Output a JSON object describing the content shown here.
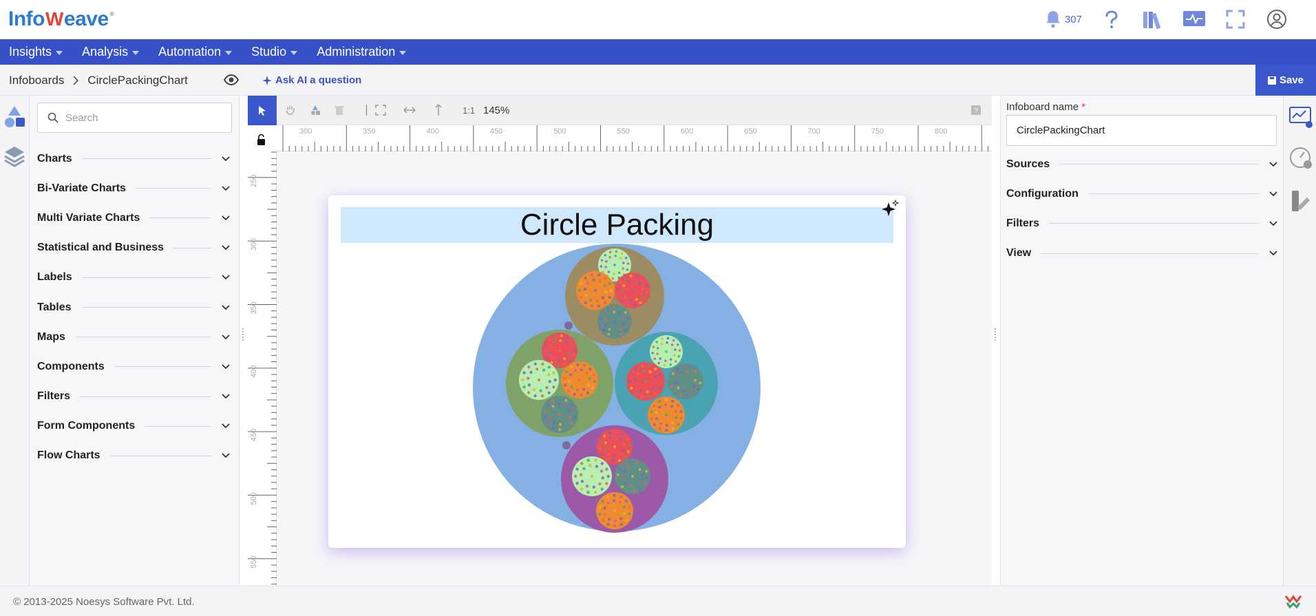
{
  "app": {
    "logo_part1": "Info",
    "logo_part2": "W",
    "logo_part3": "eave",
    "logo_reg": "®",
    "notification_count": "307"
  },
  "nav": {
    "items": [
      {
        "label": "Insights"
      },
      {
        "label": "Analysis"
      },
      {
        "label": "Automation"
      },
      {
        "label": "Studio"
      },
      {
        "label": "Administration"
      }
    ]
  },
  "breadcrumb": {
    "root": "Infoboards",
    "current": "CirclePackingChart"
  },
  "actions": {
    "ask_ai": "Ask AI a question",
    "save": "Save"
  },
  "components": {
    "search_placeholder": "Search",
    "categories": [
      {
        "label": "Charts"
      },
      {
        "label": "Bi-Variate Charts"
      },
      {
        "label": "Multi Variate Charts"
      },
      {
        "label": "Statistical and Business"
      },
      {
        "label": "Labels"
      },
      {
        "label": "Tables"
      },
      {
        "label": "Maps"
      },
      {
        "label": "Components"
      },
      {
        "label": "Filters"
      },
      {
        "label": "Form Components"
      },
      {
        "label": "Flow Charts"
      }
    ]
  },
  "toolbar": {
    "ratio": "1:1",
    "zoom": "145%"
  },
  "ruler": {
    "h_labels": [
      "300",
      "350",
      "400",
      "450",
      "500",
      "550",
      "600",
      "650",
      "700",
      "750",
      "800",
      "8"
    ],
    "v_labels": [
      "250",
      "300",
      "350",
      "400",
      "450",
      "500",
      "550"
    ]
  },
  "widget": {
    "title": "Circle Packing"
  },
  "chart_data": {
    "type": "circle-packing",
    "title": "Circle Packing",
    "groups": [
      {
        "color": "#9b8c63",
        "children": [
          "#b6f0b0",
          "#f08a2e",
          "#ee4f55",
          "#5f8f86"
        ]
      },
      {
        "color": "#7fa268",
        "children": [
          "#ee4f55",
          "#b6f0b0",
          "#f08a2e",
          "#5f8f86"
        ]
      },
      {
        "color": "#4aa3b2",
        "children": [
          "#b6f0b0",
          "#ee4f55",
          "#5f8f86",
          "#f08a2e"
        ]
      },
      {
        "color": "#9b59a8",
        "children": [
          "#ee4f55",
          "#b6f0b0",
          "#5f8f86",
          "#f08a2e"
        ]
      }
    ],
    "root_color": "#84b0e3"
  },
  "properties": {
    "infoboard_name_label": "Infoboard name",
    "required_mark": "*",
    "infoboard_name_value": "CirclePackingChart",
    "sections": [
      {
        "label": "Sources"
      },
      {
        "label": "Configuration"
      },
      {
        "label": "Filters"
      },
      {
        "label": "View"
      }
    ]
  },
  "footer": {
    "copyright": "© 2013-2025 Noesys Software Pvt. Ltd."
  }
}
